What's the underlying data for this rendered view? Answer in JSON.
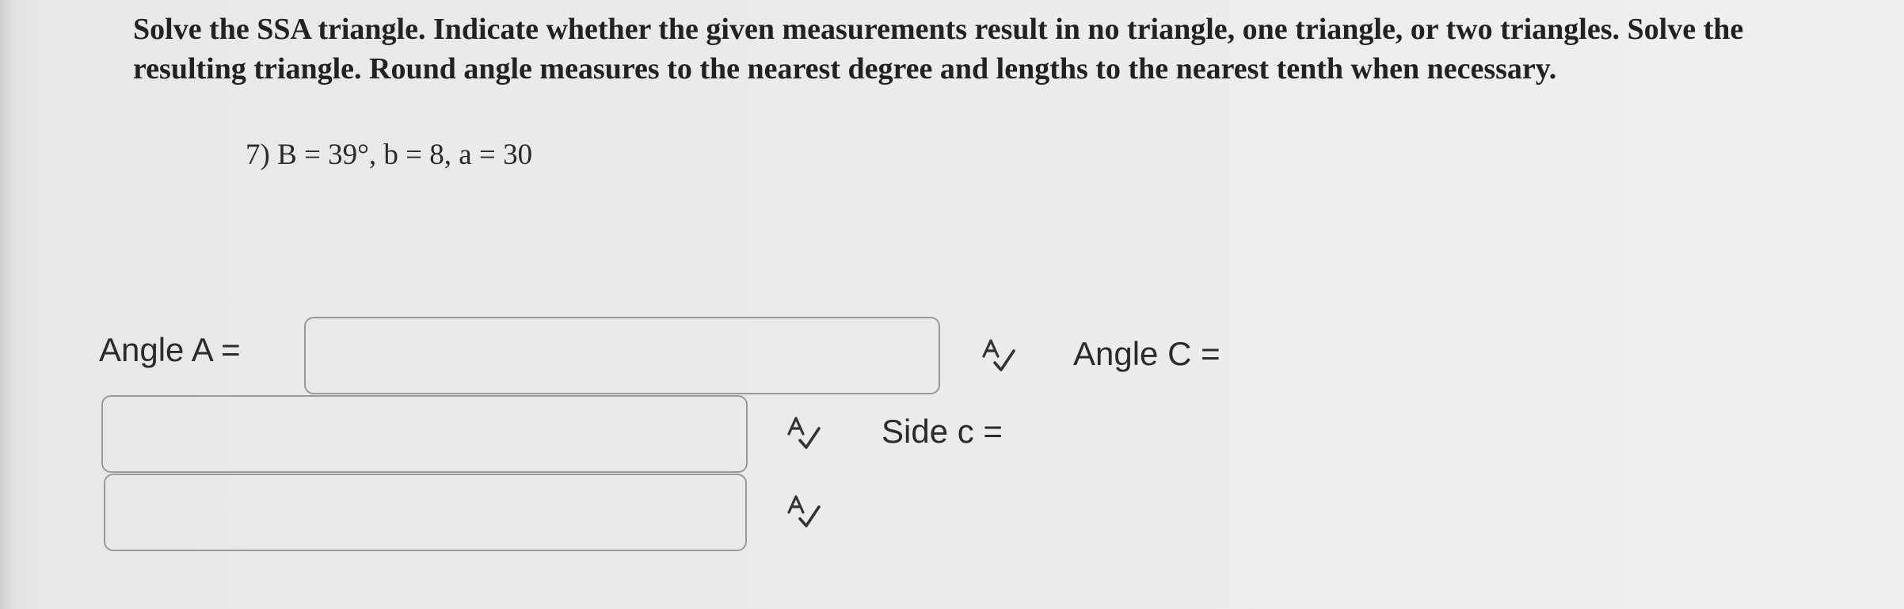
{
  "instructions": "Solve the SSA triangle. Indicate whether the given measurements result in no triangle, one triangle, or two triangles. Solve the resulting triangle. Round angle measures to the nearest degree and lengths to the nearest tenth when necessary.",
  "problem": "7) B = 39°, b = 8, a = 30",
  "fields": {
    "angle_a_label": "Angle A =",
    "angle_a_value": "",
    "angle_c_label": "Angle C =",
    "angle_c_value": "",
    "side_c_label": "Side c =",
    "side_c_value": ""
  },
  "icons": {
    "spellcheck": "spellcheck-icon"
  }
}
